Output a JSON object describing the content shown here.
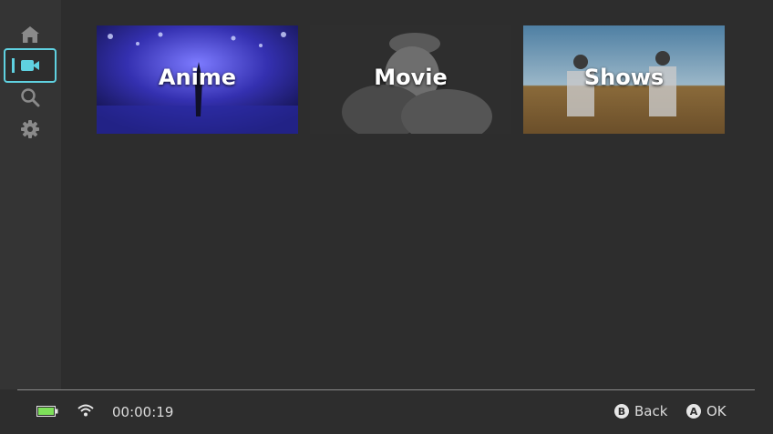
{
  "sidebar": {
    "items": [
      {
        "name": "home",
        "icon": "home-icon"
      },
      {
        "name": "videos",
        "icon": "video-camera-icon",
        "active": true
      },
      {
        "name": "search",
        "icon": "search-icon"
      },
      {
        "name": "settings",
        "icon": "gear-icon"
      }
    ],
    "accent_color": "#5fd1e0"
  },
  "categories": [
    {
      "label": "Anime"
    },
    {
      "label": "Movie"
    },
    {
      "label": "Shows"
    }
  ],
  "footer": {
    "battery_icon": "battery-icon",
    "battery_color": "#7ee05a",
    "wifi_icon": "wifi-icon",
    "time": "00:00:19",
    "hints": [
      {
        "button": "B",
        "label": "Back"
      },
      {
        "button": "A",
        "label": "OK"
      }
    ]
  }
}
